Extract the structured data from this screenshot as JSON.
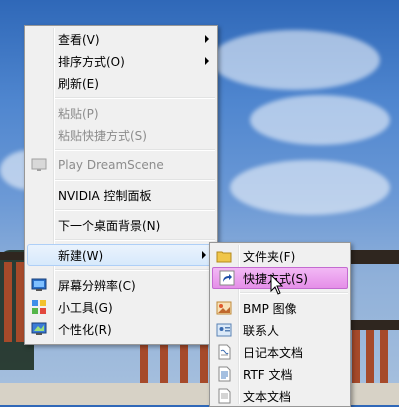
{
  "context_menu": {
    "view": "查看(V)",
    "sort_by": "排序方式(O)",
    "refresh": "刷新(E)",
    "paste": "粘贴(P)",
    "paste_shortcut": "粘贴快捷方式(S)",
    "play_dreamscene": "Play DreamScene",
    "nvidia_panel": "NVIDIA 控制面板",
    "next_background": "下一个桌面背景(N)",
    "new": "新建(W)",
    "screen_resolution": "屏幕分辨率(C)",
    "gadgets": "小工具(G)",
    "personalize": "个性化(R)"
  },
  "new_submenu": {
    "folder": "文件夹(F)",
    "shortcut": "快捷方式(S)",
    "bmp_image": "BMP 图像",
    "contact": "联系人",
    "journal_document": "日记本文档",
    "rtf_document": "RTF 文档",
    "text_document": "文本文档"
  },
  "icons": {
    "dreamscene": "dreamscene-icon",
    "screen_resolution": "monitor-icon",
    "gadgets": "gadgets-icon",
    "personalize": "personalize-icon",
    "folder": "folder-icon",
    "shortcut": "shortcut-icon",
    "bmp_image": "bmp-image-icon",
    "contact": "contact-icon",
    "journal_document": "journal-icon",
    "rtf_document": "rtf-icon",
    "text_document": "text-file-icon"
  },
  "colors": {
    "highlight_pink": "#e58fe8",
    "active_blue": "#d7e9fb",
    "menu_bg": "#f0f0f0",
    "disabled_text": "#8c8c8c"
  }
}
